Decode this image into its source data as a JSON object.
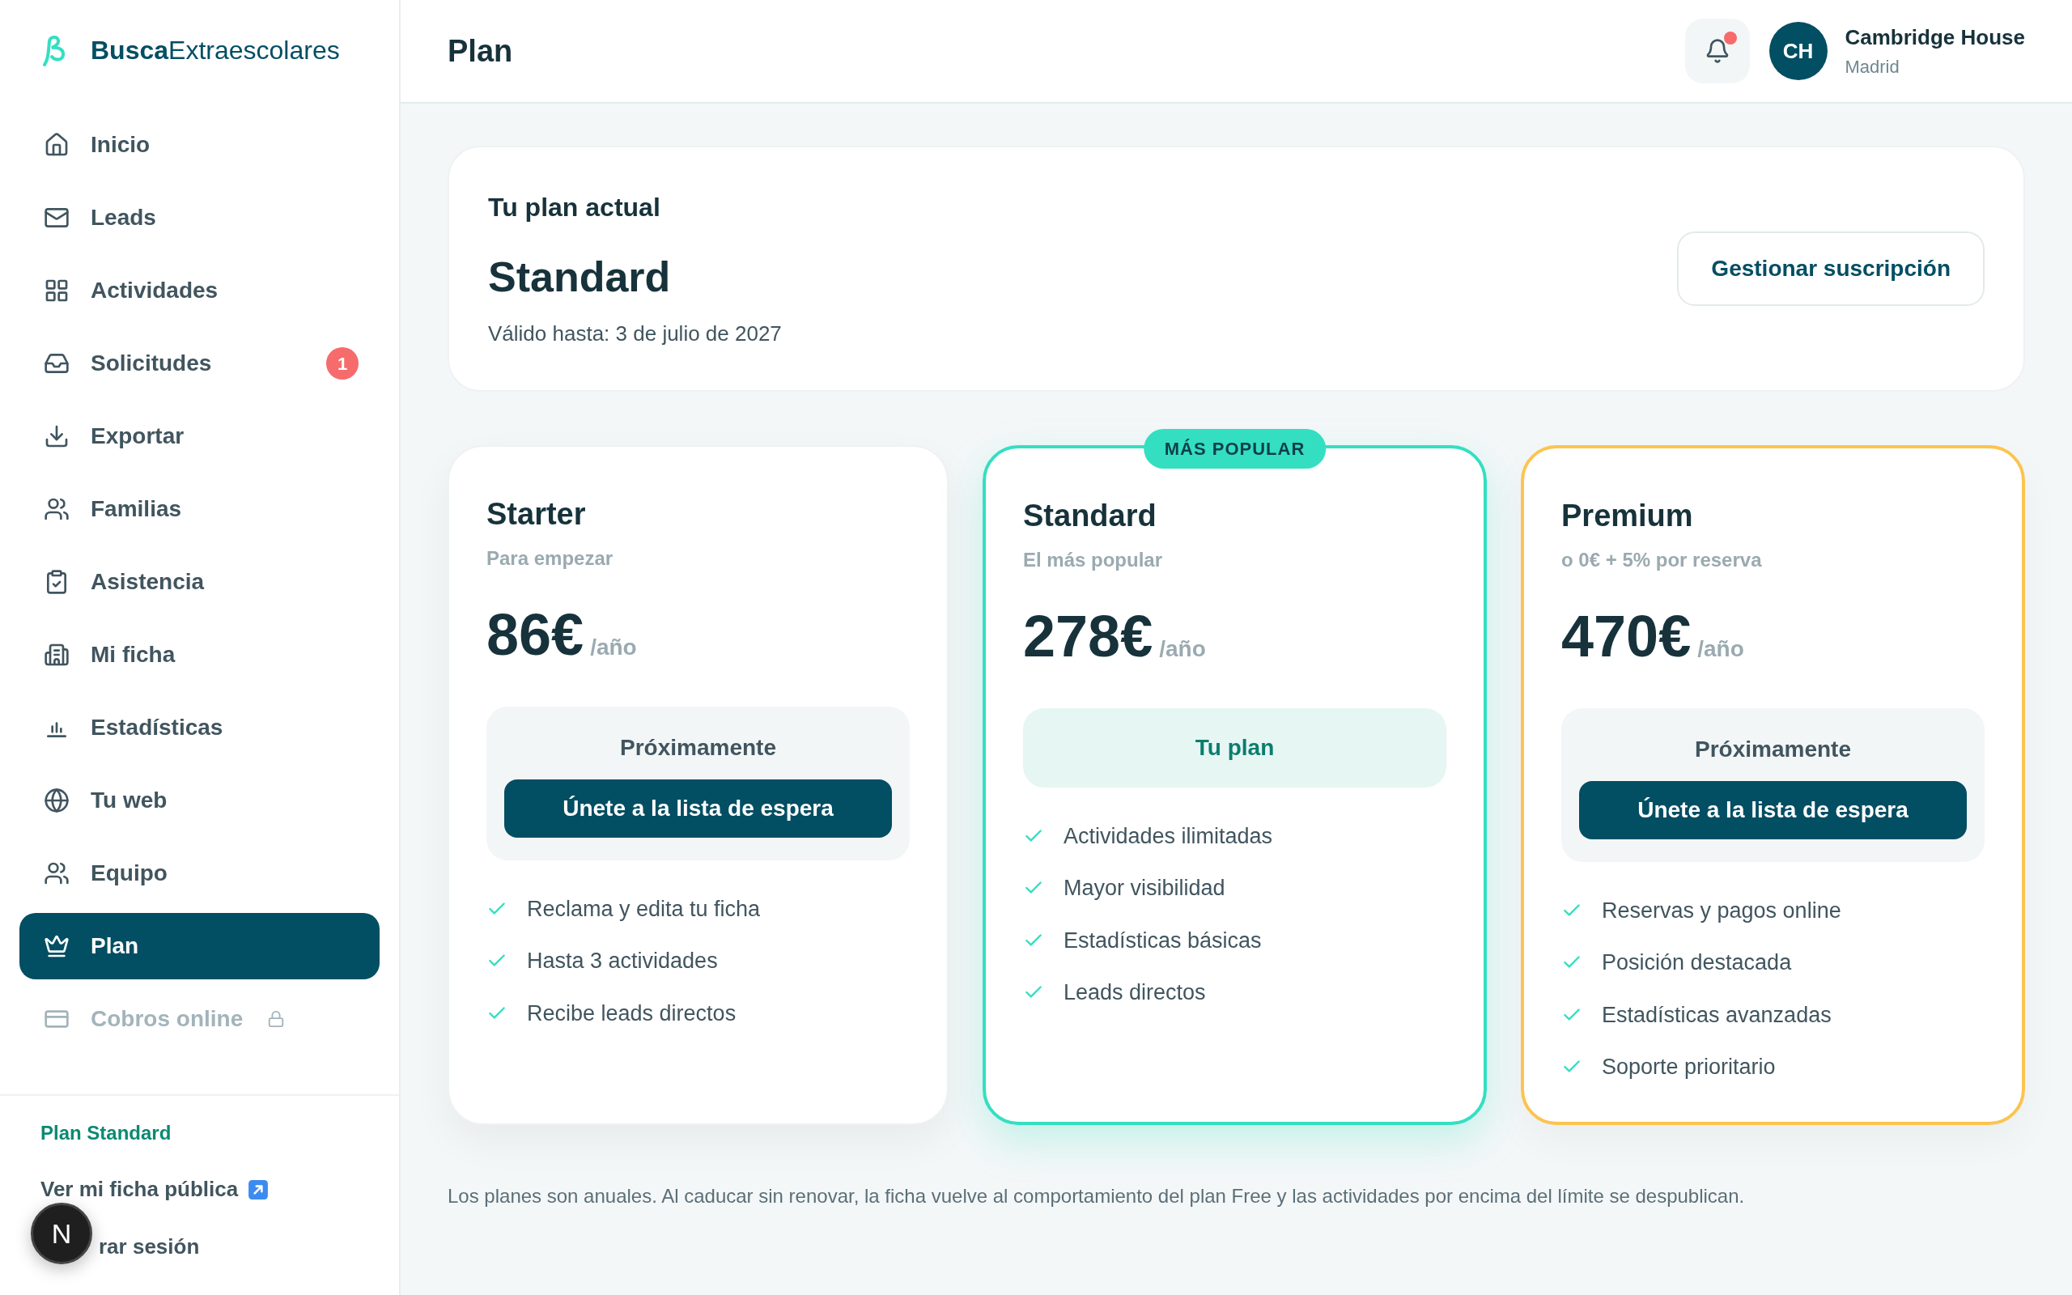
{
  "brand": {
    "bold": "Busca",
    "regular": "Extraescolares"
  },
  "sidebar": {
    "items": [
      {
        "label": "Inicio",
        "selected": false,
        "disabled": false
      },
      {
        "label": "Leads",
        "selected": false,
        "disabled": false
      },
      {
        "label": "Actividades",
        "selected": false,
        "disabled": false
      },
      {
        "label": "Solicitudes",
        "selected": false,
        "disabled": false,
        "badge": "1"
      },
      {
        "label": "Exportar",
        "selected": false,
        "disabled": false
      },
      {
        "label": "Familias",
        "selected": false,
        "disabled": false
      },
      {
        "label": "Asistencia",
        "selected": false,
        "disabled": false
      },
      {
        "label": "Mi ficha",
        "selected": false,
        "disabled": false
      },
      {
        "label": "Estadísticas",
        "selected": false,
        "disabled": false
      },
      {
        "label": "Tu web",
        "selected": false,
        "disabled": false
      },
      {
        "label": "Equipo",
        "selected": false,
        "disabled": false
      },
      {
        "label": "Plan",
        "selected": true,
        "disabled": false
      },
      {
        "label": "Cobros online",
        "selected": false,
        "disabled": true
      }
    ],
    "plan_label": "Plan Standard",
    "public_link": "Ver mi ficha pública",
    "logout": "rar sesión"
  },
  "dev_indicator": {
    "label": "N"
  },
  "header": {
    "title": "Plan",
    "notifications": {
      "unread": true
    },
    "user": {
      "initials": "CH",
      "name": "Cambridge House",
      "location": "Madrid"
    }
  },
  "current_plan": {
    "heading": "Tu plan actual",
    "name": "Standard",
    "valid_until": "Válido hasta: 3 de julio de 2027",
    "button": "Gestionar suscripción"
  },
  "plans": [
    {
      "kind": "basic",
      "name": "Starter",
      "subtitle": "Para empezar",
      "price": "86€",
      "period": "/año",
      "status": "Próximamente",
      "button": "Únete a la lista de espera",
      "features": [
        "Reclama y edita tu ficha",
        "Hasta 3 actividades",
        "Recibe leads directos"
      ]
    },
    {
      "kind": "current",
      "badge": "MÁS POPULAR",
      "name": "Standard",
      "subtitle": "El más popular",
      "price": "278€",
      "period": "/año",
      "status": "Tu plan",
      "features": [
        "Actividades ilimitadas",
        "Mayor visibilidad",
        "Estadísticas básicas",
        "Leads directos"
      ]
    },
    {
      "kind": "featured",
      "name": "Premium",
      "subtitle": "o 0€ + 5% por reserva",
      "price": "470€",
      "period": "/año",
      "status": "Próximamente",
      "button": "Únete a la lista de espera",
      "features": [
        "Reservas y pagos online",
        "Posición destacada",
        "Estadísticas avanzadas",
        "Soporte prioritario"
      ]
    }
  ],
  "note": "Los planes son anuales. Al caducar sin renovar, la ficha vuelve al comportamiento del plan Free y las actividades por encima del límite se despublican."
}
